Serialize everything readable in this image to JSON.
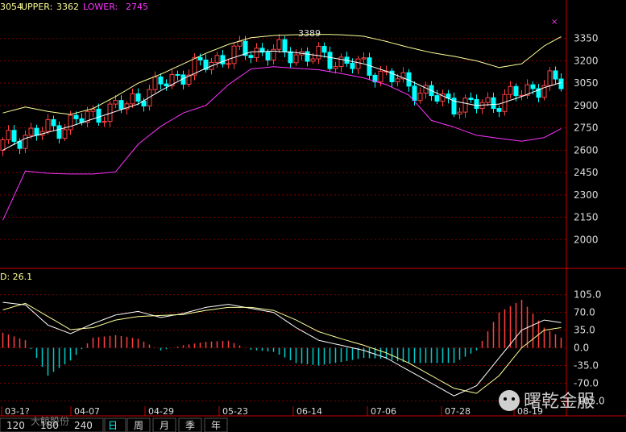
{
  "header": {
    "mid_label": "3054",
    "upper_label": "UPPER:",
    "upper_value": "3362",
    "lower_label": "LOWER:",
    "lower_value": "2745",
    "osc_label": "D: 26.1",
    "peak_label": "3389"
  },
  "colors": {
    "background": "#000000",
    "up": "#ff4040",
    "down": "#00ffff",
    "upper_band": "#ffff99",
    "lower_band": "#ff33ff",
    "mid_band": "#ffffff",
    "grid": "#8b0000",
    "axis": "#cc0000"
  },
  "chart_data": [
    {
      "type": "candlestick",
      "title": "",
      "y_ticks": [
        "3350",
        "3200",
        "3050",
        "2900",
        "2750",
        "2600",
        "2450",
        "2300",
        "2150",
        "2000"
      ],
      "ylim": [
        1850,
        3500
      ],
      "x_ticks": [
        "03-1?",
        "04-07",
        "04-29",
        "05-23",
        "06-14",
        "07-06",
        "07-28",
        "08-19"
      ],
      "annotations": [
        {
          "text": "3389",
          "value": 3389
        }
      ],
      "series": [
        {
          "name": "UPPER",
          "color": "#ffff99",
          "x": [
            0,
            4,
            8,
            12,
            16,
            20,
            24,
            28,
            32,
            36,
            40,
            44,
            48,
            52,
            56,
            60,
            64,
            68,
            72,
            76,
            80,
            84,
            88,
            92,
            96,
            99
          ],
          "values": [
            2850,
            2890,
            2860,
            2840,
            2880,
            2960,
            3050,
            3110,
            3180,
            3250,
            3310,
            3355,
            3370,
            3375,
            3378,
            3375,
            3365,
            3330,
            3290,
            3255,
            3230,
            3200,
            3155,
            3180,
            3300,
            3362
          ]
        },
        {
          "name": "MID",
          "color": "#ffffff",
          "x": [
            0,
            4,
            8,
            12,
            16,
            20,
            24,
            28,
            32,
            36,
            40,
            44,
            48,
            52,
            56,
            60,
            64,
            68,
            72,
            76,
            80,
            84,
            88,
            92,
            96,
            99
          ],
          "values": [
            2600,
            2680,
            2720,
            2760,
            2810,
            2860,
            2910,
            3000,
            3080,
            3150,
            3210,
            3260,
            3265,
            3255,
            3235,
            3210,
            3180,
            3130,
            3070,
            3000,
            2930,
            2900,
            2910,
            2960,
            3020,
            3054
          ]
        },
        {
          "name": "LOWER",
          "color": "#ff33ff",
          "x": [
            0,
            4,
            8,
            12,
            16,
            20,
            24,
            28,
            32,
            36,
            40,
            44,
            48,
            52,
            56,
            60,
            64,
            68,
            72,
            76,
            80,
            84,
            88,
            92,
            96,
            99
          ],
          "values": [
            2130,
            2460,
            2445,
            2440,
            2440,
            2455,
            2640,
            2760,
            2850,
            2900,
            3040,
            3145,
            3160,
            3150,
            3140,
            3115,
            3085,
            3040,
            2970,
            2800,
            2755,
            2700,
            2680,
            2660,
            2685,
            2745
          ]
        }
      ]
    },
    {
      "type": "macd",
      "title": "",
      "y_ticks": [
        "105.0",
        "70.0",
        "35.0",
        "0.0",
        "-35.0",
        "-70.0",
        "-105.0"
      ],
      "ylim": [
        -125,
        130
      ],
      "series": [
        {
          "name": "DIF",
          "color": "#ffffff",
          "x": [
            0,
            4,
            8,
            12,
            16,
            20,
            24,
            28,
            32,
            36,
            40,
            44,
            48,
            52,
            56,
            60,
            64,
            68,
            72,
            76,
            80,
            84,
            88,
            92,
            96,
            99
          ],
          "values": [
            90,
            85,
            45,
            28,
            48,
            65,
            72,
            60,
            68,
            80,
            86,
            78,
            70,
            40,
            15,
            5,
            -5,
            -20,
            -45,
            -70,
            -95,
            -75,
            -20,
            35,
            55,
            50
          ]
        },
        {
          "name": "DEA",
          "color": "#ffff99",
          "x": [
            0,
            4,
            8,
            12,
            16,
            20,
            24,
            28,
            32,
            36,
            40,
            44,
            48,
            52,
            56,
            60,
            64,
            68,
            72,
            76,
            80,
            84,
            88,
            92,
            96,
            99
          ],
          "values": [
            75,
            88,
            62,
            36,
            40,
            55,
            62,
            64,
            66,
            74,
            80,
            80,
            74,
            55,
            32,
            18,
            5,
            -10,
            -30,
            -55,
            -80,
            -90,
            -55,
            0,
            35,
            40
          ]
        },
        {
          "name": "MACD",
          "color": "#ff4040",
          "x": [
            0,
            4,
            8,
            12,
            16,
            20,
            24,
            28,
            32,
            36,
            40,
            44,
            48,
            52,
            56,
            60,
            64,
            68,
            72,
            76,
            80,
            84,
            88,
            92,
            96,
            99
          ],
          "values": [
            30,
            15,
            -55,
            -25,
            20,
            25,
            18,
            -5,
            5,
            12,
            14,
            -4,
            -8,
            -30,
            -35,
            -28,
            -20,
            -22,
            -30,
            -30,
            -30,
            -5,
            70,
            95,
            40,
            20
          ]
        }
      ]
    }
  ],
  "tabs": [
    {
      "label": "120",
      "active": false
    },
    {
      "label": "180",
      "active": false
    },
    {
      "label": "240",
      "active": false
    },
    {
      "label": "日",
      "active": true
    },
    {
      "label": "周",
      "active": false
    },
    {
      "label": "月",
      "active": false
    },
    {
      "label": "季",
      "active": false
    },
    {
      "label": "年",
      "active": false
    }
  ],
  "watermark": {
    "text": "曙乾金服",
    "faint_text": "大鲸股份"
  }
}
